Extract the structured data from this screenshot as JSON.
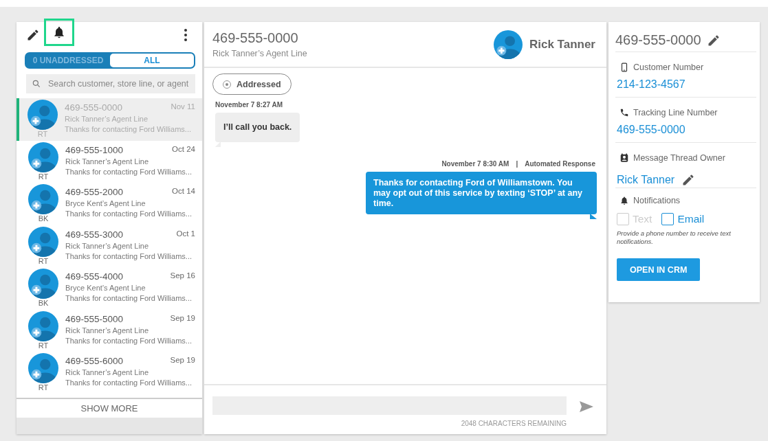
{
  "sidebar": {
    "notifications_highlighted": true,
    "filters": [
      {
        "label": "0 UNADDRESSED",
        "selected": false
      },
      {
        "label": "ALL",
        "selected": true
      }
    ],
    "search": {
      "placeholder": "Search customer, store line, or agent"
    },
    "conversations": [
      {
        "number": "469-555-0000",
        "line": "Rick Tanner’s Agent Line",
        "preview": "Thanks for contacting Ford Williams...",
        "date": "Nov 11",
        "initials": "RT",
        "selected": true
      },
      {
        "number": "469-555-1000",
        "line": "Rick Tanner’s Agent Line",
        "preview": "Thanks for contacting Ford Williams...",
        "date": "Oct 24",
        "initials": "RT",
        "selected": false
      },
      {
        "number": "469-555-2000",
        "line": "Bryce Kent’s Agent Line",
        "preview": "Thanks for contacting Ford Williams...",
        "date": "Oct 14",
        "initials": "BK",
        "selected": false
      },
      {
        "number": "469-555-3000",
        "line": "Rick Tanner’s Agent Line",
        "preview": "Thanks for contacting Ford Williams...",
        "date": "Oct 1",
        "initials": "RT",
        "selected": false
      },
      {
        "number": "469-555-4000",
        "line": "Bryce Kent’s Agent Line",
        "preview": "Thanks for contacting Ford Williams...",
        "date": "Sep 16",
        "initials": "BK",
        "selected": false
      },
      {
        "number": "469-555-5000",
        "line": "Rick Tanner’s Agent Line",
        "preview": "Thanks for contacting Ford Williams...",
        "date": "Sep 19",
        "initials": "RT",
        "selected": false
      },
      {
        "number": "469-555-6000",
        "line": "Rick Tanner’s Agent Line",
        "preview": "Thanks for contacting Ford Williams...",
        "date": "Sep 19",
        "initials": "RT",
        "selected": false
      }
    ],
    "show_more": "SHOW MORE"
  },
  "thread": {
    "number": "469-555-0000",
    "line": "Rick Tanner’s Agent Line",
    "owner": "Rick Tanner",
    "addressed": {
      "label": "Addressed"
    },
    "messages": [
      {
        "kind": "incoming",
        "time": "November 7 8:27 AM",
        "text": "I’ll call you back."
      },
      {
        "kind": "outgoing",
        "time": "November 7 8:30 AM",
        "separator": "|",
        "source": "Automated Response",
        "text": "Thanks for contacting Ford of Williamstown. You may opt out of this service by texting ‘STOP’ at any time."
      }
    ],
    "counter": "2048 CHARACTERS REMAINING"
  },
  "details": {
    "title": "469-555-0000",
    "fields": [
      {
        "kind": "phone",
        "label": "Customer Number",
        "value": "214-123-4567"
      },
      {
        "kind": "call",
        "label": "Tracking Line Number",
        "value": "469-555-0000"
      },
      {
        "kind": "owner",
        "label": "Message Thread Owner",
        "value": "Rick Tanner",
        "editable": true
      }
    ],
    "notifications": {
      "label": "Notifications",
      "options": [
        {
          "label": "Text",
          "checked": false,
          "disabled": true
        },
        {
          "label": "Email",
          "checked": false,
          "disabled": false
        }
      ],
      "hint": "Provide a phone number to receive text notifications."
    },
    "button": "OPEN IN CRM"
  }
}
